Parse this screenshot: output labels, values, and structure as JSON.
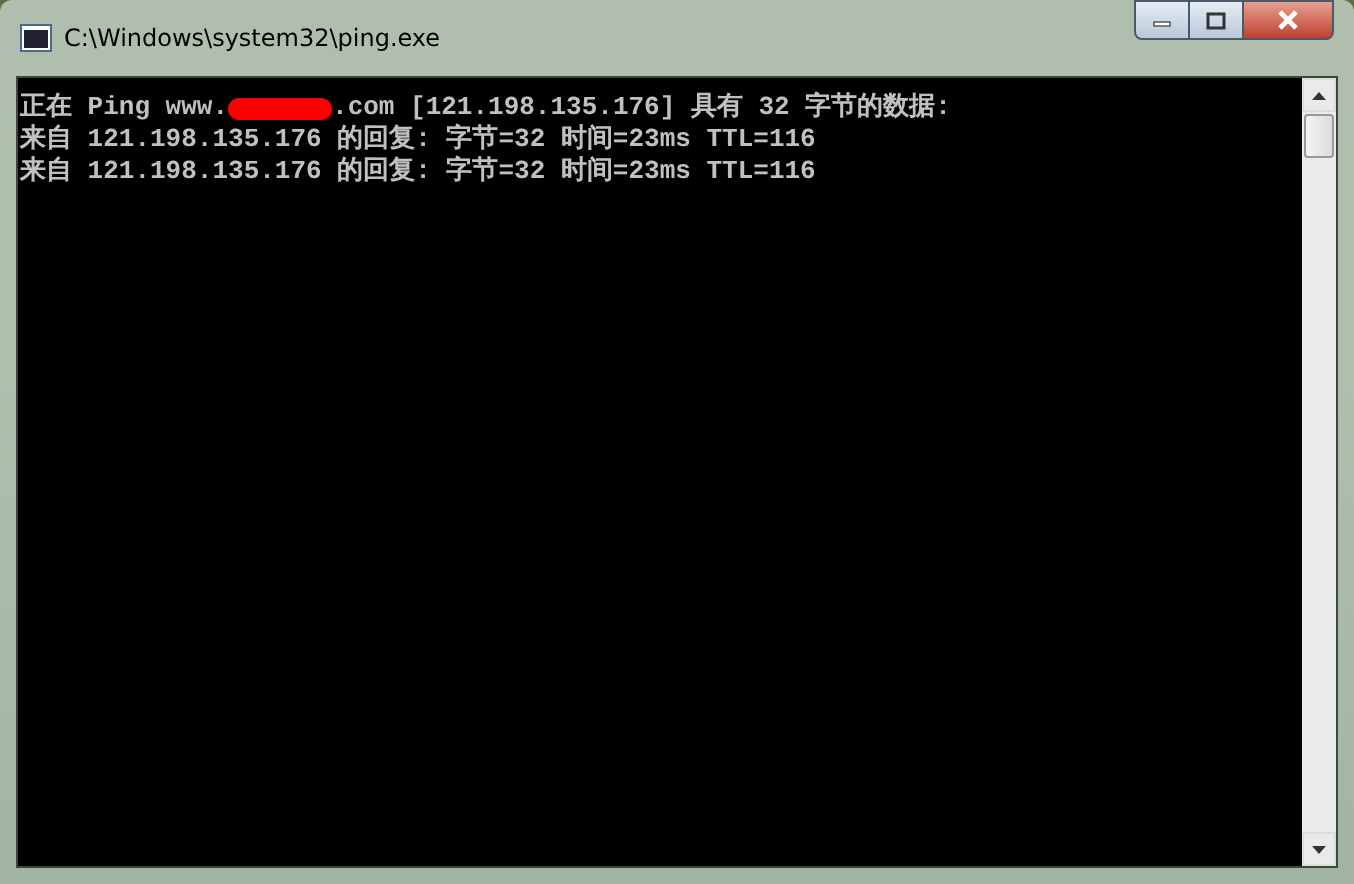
{
  "window": {
    "title": "C:\\Windows\\system32\\ping.exe"
  },
  "console": {
    "lines": [
      {
        "segments": [
          {
            "kind": "text",
            "text": "正在 Ping www."
          },
          {
            "kind": "redaction"
          },
          {
            "kind": "text",
            "text": ".com [121.198.135.176] 具有 32 字节的数据:"
          }
        ]
      },
      {
        "segments": [
          {
            "kind": "text",
            "text": "来自 121.198.135.176 的回复: 字节=32 时间=23ms TTL=116"
          }
        ]
      },
      {
        "segments": [
          {
            "kind": "text",
            "text": "来自 121.198.135.176 的回复: 字节=32 时间=23ms TTL=116"
          }
        ]
      }
    ]
  }
}
